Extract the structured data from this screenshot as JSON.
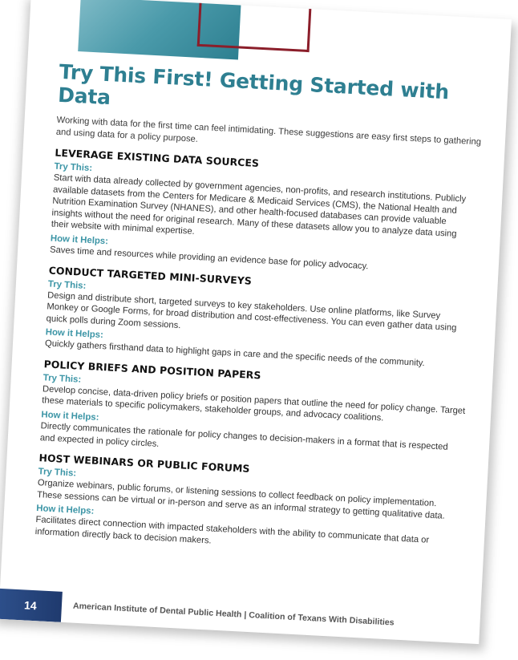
{
  "page": {
    "title": "Try This First! Getting Started with Data",
    "intro": "Working with data for the first time can feel intimidating. These suggestions are easy first steps to gathering and using data for a policy purpose.",
    "sections": [
      {
        "heading": "LEVERAGE EXISTING DATA SOURCES",
        "try_label": "Try This:",
        "try_text": "Start with data already collected by government agencies, non-profits, and research institutions. Publicly available datasets from the Centers for Medicare & Medicaid Services (CMS), the National Health and Nutrition Examination Survey (NHANES), and other health-focused databases can provide valuable insights without the need for original research. Many of these datasets allow you to analyze data using their website with minimal expertise.",
        "help_label": "How it Helps:",
        "help_text": "Saves time and resources while providing an evidence base for policy advocacy."
      },
      {
        "heading": "CONDUCT TARGETED MINI-SURVEYS",
        "try_label": "Try This:",
        "try_text": "Design and distribute short, targeted surveys to key stakeholders. Use online platforms, like Survey Monkey or Google Forms, for broad distribution and cost-effectiveness. You can even gather data using quick polls during Zoom sessions.",
        "help_label": "How it Helps:",
        "help_text": "Quickly gathers firsthand data to highlight gaps in care and the specific needs of the community."
      },
      {
        "heading": "POLICY BRIEFS AND POSITION PAPERS",
        "try_label": "Try This:",
        "try_text": "Develop concise, data-driven policy briefs or position papers that outline the need for policy change. Target these materials to specific policymakers, stakeholder groups, and advocacy coalitions.",
        "help_label": "How it Helps:",
        "help_text": "Directly communicates the rationale for policy changes to decision-makers in a format that is respected and expected in policy circles."
      },
      {
        "heading": "HOST WEBINARS OR PUBLIC FORUMS",
        "try_label": "Try This:",
        "try_text": "Organize webinars, public forums, or listening sessions to collect feedback on policy implementation. These sessions can be virtual or in-person and serve as an informal strategy to getting qualitative data.",
        "help_label": "How it Helps:",
        "help_text": "Facilitates direct connection with impacted stakeholders with the ability to communicate that data or information directly back to decision makers."
      }
    ],
    "footer": {
      "page_number": "14",
      "text": "American Institute of Dental Public Health | Coalition of Texans With Disabilities"
    }
  },
  "colors": {
    "title": "#2e7f91",
    "label": "#3c95a6",
    "accent_red": "#8b1e2a",
    "footer_blue": "#1f3a6e"
  }
}
